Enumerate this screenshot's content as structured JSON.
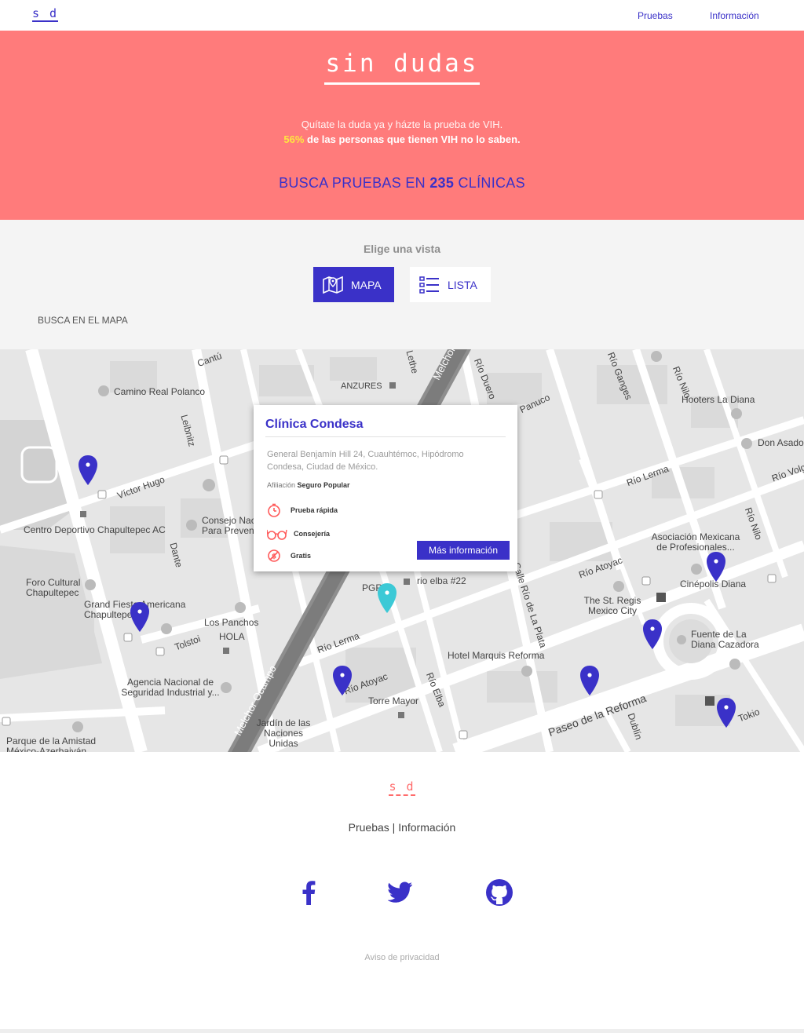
{
  "nav": {
    "logo": "s d",
    "links": [
      "Pruebas",
      "Información"
    ]
  },
  "hero": {
    "title": "sin dudas",
    "line1": "Quítate la duda ya y házte la prueba de VIH.",
    "line2_pct": "56%",
    "line2_rest": "de las personas que tienen VIH no lo saben.",
    "search_pre": "BUSCA PRUEBAS EN",
    "search_count": "235",
    "search_post": "CLÍNICAS"
  },
  "views": {
    "label": "Elige una vista",
    "map_button": "MAPA",
    "list_button": "LISTA",
    "section_label": "BUSCA EN EL MAPA"
  },
  "map": {
    "labels": [
      "Cantú",
      "ANZURES",
      "Camino Real Polanco",
      "Leibnitz",
      "Víctor Hugo",
      "Centro Deportivo Chapultepec AC",
      "Consejo Nac",
      "Para Preven",
      "Dante",
      "Foro Cultural Chapultepec",
      "Grand Fiesta Americana Chapultepec",
      "Los Panchos",
      "HOLA",
      "Tolstoi",
      "Agencia Nacional de Seguridad Industrial y...",
      "Parque de la Amistad México-Azerbaiyán",
      "Jardín de las Naciones Unidas",
      "Melchor Ocampo",
      "Río Lerma",
      "Río Atoyac",
      "Torre Mayor",
      "Río Elba",
      "rio elba #22",
      "PGR",
      "Hotel Marquis Reforma",
      "Calle Río de La Plata",
      "The St. Regis Mexico City",
      "Río Atoyac",
      "Paseo de la Reforma",
      "Dublín",
      "Fuente de La Diana Cazadora",
      "Cinépolis Diana",
      "Asociación Mexicana de Profesionales...",
      "Río Lerma",
      "Río Nilo",
      "Hooters La Diana",
      "Don Asado",
      "Río Ganges",
      "Río Duero",
      "Panuco",
      "Río Volga",
      "Tokio",
      "Melchor",
      "Lethe",
      "Río Nilo"
    ]
  },
  "popup": {
    "title": "Clínica Condesa",
    "address": "General Benjamín Hill 24, Cuauhtémoc, Hipódromo Condesa, Ciudad de México.",
    "afil_label": "Afiliación",
    "afil_value": "Seguro Popular",
    "services": [
      "Prueba rápida",
      "Consejería",
      "Gratis"
    ],
    "button": "Más información"
  },
  "footer": {
    "logo": "s d",
    "link1": "Pruebas",
    "separator": "|",
    "link2": "Información",
    "privacy": "Aviso de privacidad",
    "social": [
      "facebook-icon",
      "twitter-icon",
      "github-icon"
    ]
  },
  "colors": {
    "accent": "#3a31c8",
    "hero_bg": "#ff7b7b",
    "highlight": "#ffe640",
    "selected_pin": "#3cc9d6"
  }
}
